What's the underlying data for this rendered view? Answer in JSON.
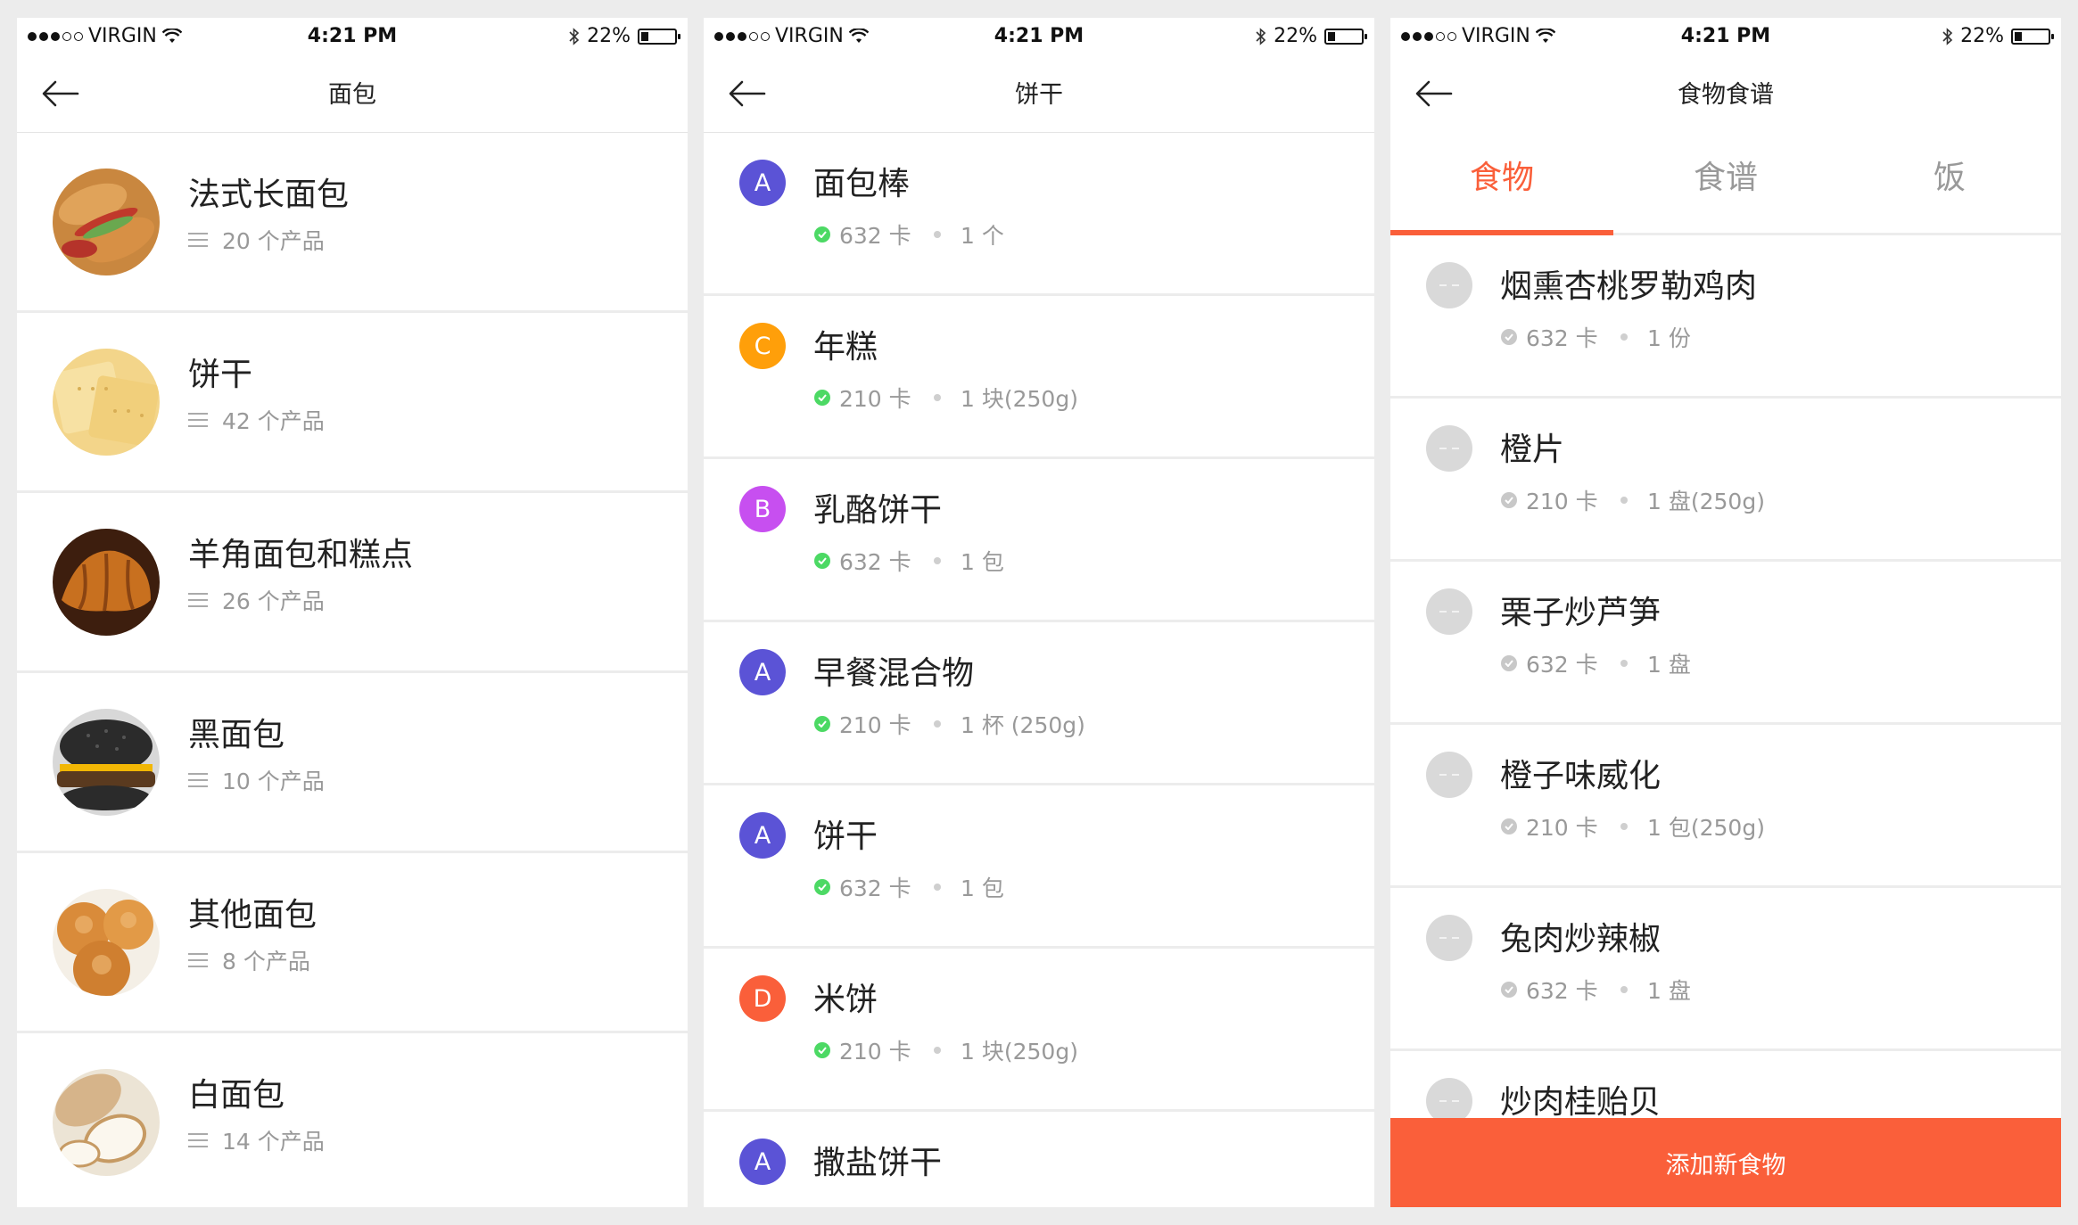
{
  "status_bar": {
    "carrier": "VIRGIN",
    "time": "4:21 PM",
    "battery": "22%",
    "battery_level": 0.22
  },
  "screen1": {
    "title": "面包",
    "categories": [
      {
        "name": "法式长面包",
        "count": "20 个产品",
        "image": "baguette-sandwich"
      },
      {
        "name": "饼干",
        "count": "42 个产品",
        "image": "crackers"
      },
      {
        "name": "羊角面包和糕点",
        "count": "26 个产品",
        "image": "croissant"
      },
      {
        "name": "黑面包",
        "count": "10 个产品",
        "image": "black-bun-burger"
      },
      {
        "name": "其他面包",
        "count": "8 个产品",
        "image": "round-buns"
      },
      {
        "name": "白面包",
        "count": "14 个产品",
        "image": "white-bread"
      }
    ]
  },
  "screen2": {
    "title": "饼干",
    "items": [
      {
        "badge": "A",
        "badge_color": "#5b53d6",
        "name": "面包棒",
        "kcal": "632 卡",
        "portion": "1 个"
      },
      {
        "badge": "C",
        "badge_color": "#ff9f0a",
        "name": "年糕",
        "kcal": "210 卡",
        "portion": "1 块(250g)"
      },
      {
        "badge": "B",
        "badge_color": "#c74ff0",
        "name": "乳酪饼干",
        "kcal": "632 卡",
        "portion": "1 包"
      },
      {
        "badge": "A",
        "badge_color": "#5b53d6",
        "name": "早餐混合物",
        "kcal": "210 卡",
        "portion": "1 杯 (250g)"
      },
      {
        "badge": "A",
        "badge_color": "#5b53d6",
        "name": "饼干",
        "kcal": "632 卡",
        "portion": "1 包"
      },
      {
        "badge": "D",
        "badge_color": "#fa5f3a",
        "name": "米饼",
        "kcal": "210 卡",
        "portion": "1 块(250g)"
      },
      {
        "badge": "A",
        "badge_color": "#5b53d6",
        "name": "撒盐饼干",
        "kcal": "",
        "portion": ""
      }
    ]
  },
  "screen3": {
    "title": "食物食谱",
    "tabs": [
      "食物",
      "食谱",
      "饭"
    ],
    "active_tab": 0,
    "items": [
      {
        "name": "烟熏杏桃罗勒鸡肉",
        "kcal": "632 卡",
        "portion": "1 份"
      },
      {
        "name": "橙片",
        "kcal": "210 卡",
        "portion": "1 盘(250g)"
      },
      {
        "name": "栗子炒芦笋",
        "kcal": "632 卡",
        "portion": "1 盘"
      },
      {
        "name": "橙子味威化",
        "kcal": "210 卡",
        "portion": "1 包(250g)"
      },
      {
        "name": "兔肉炒辣椒",
        "kcal": "632 卡",
        "portion": "1 盘"
      },
      {
        "name": "炒肉桂贻贝",
        "kcal": "",
        "portion": ""
      }
    ],
    "add_button": "添加新食物"
  },
  "colors": {
    "accent": "#fa5f3a",
    "check_green": "#4cd964"
  }
}
